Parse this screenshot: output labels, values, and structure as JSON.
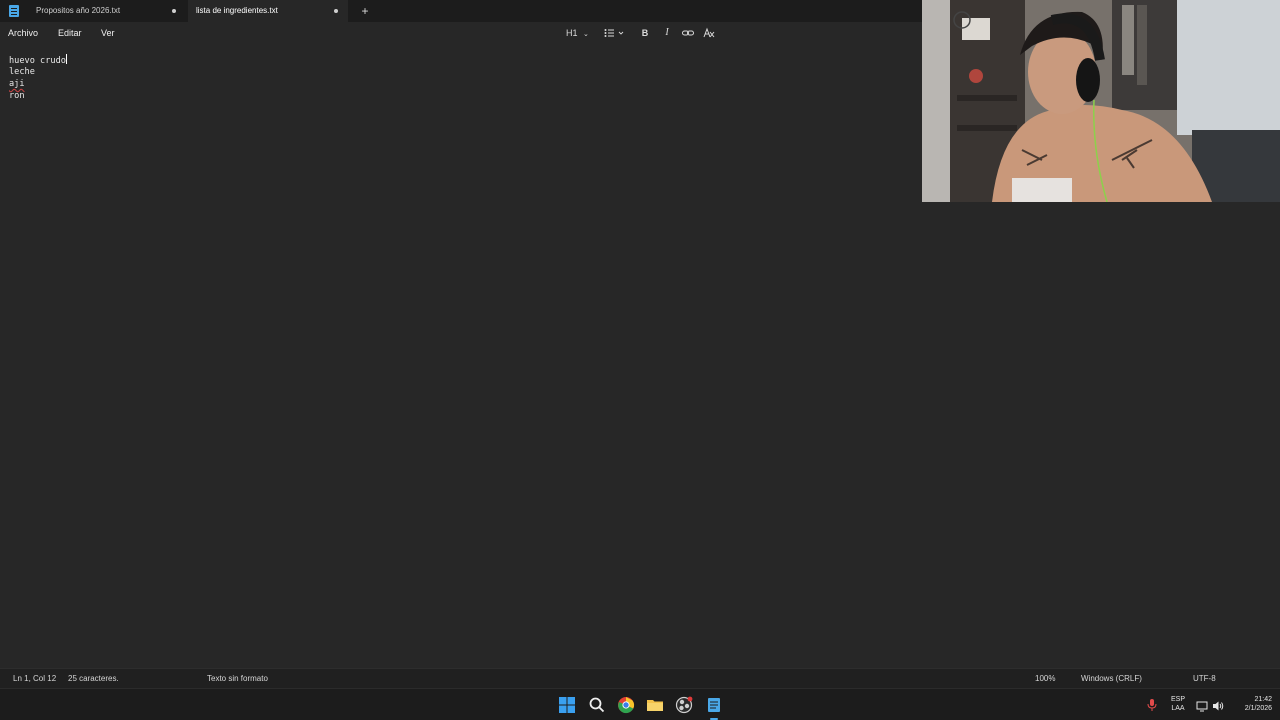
{
  "tabs": [
    {
      "label": "Propositos año 2026.txt",
      "unsaved": true,
      "active": false
    },
    {
      "label": "lista de ingredientes.txt",
      "unsaved": true,
      "active": true
    }
  ],
  "new_tab_label": "+",
  "menu": {
    "archivo": "Archivo",
    "editar": "Editar",
    "ver": "Ver"
  },
  "toolbar": {
    "heading": "H1",
    "bold": "B",
    "italic": "I"
  },
  "editor": {
    "lines": [
      "huevo crudo",
      "leche",
      "aji",
      "ron"
    ]
  },
  "status": {
    "position": "Ln 1, Col 12",
    "chars": "25 caracteres.",
    "format": "Texto sin formato",
    "zoom": "100%",
    "line_ending": "Windows (CRLF)",
    "encoding": "UTF-8"
  },
  "taskbar": {
    "icons": [
      "windows-start-icon",
      "search-icon",
      "chrome-icon",
      "file-explorer-icon",
      "obs-icon",
      "notepad-icon"
    ]
  },
  "tray": {
    "lang_top": "ESP",
    "lang_bottom": "LAA",
    "time": "21:42",
    "date": "2/1/2026"
  },
  "colors": {
    "accent": "#4aa8e8",
    "background": "#272727",
    "tabbar": "#1c1c1c"
  }
}
